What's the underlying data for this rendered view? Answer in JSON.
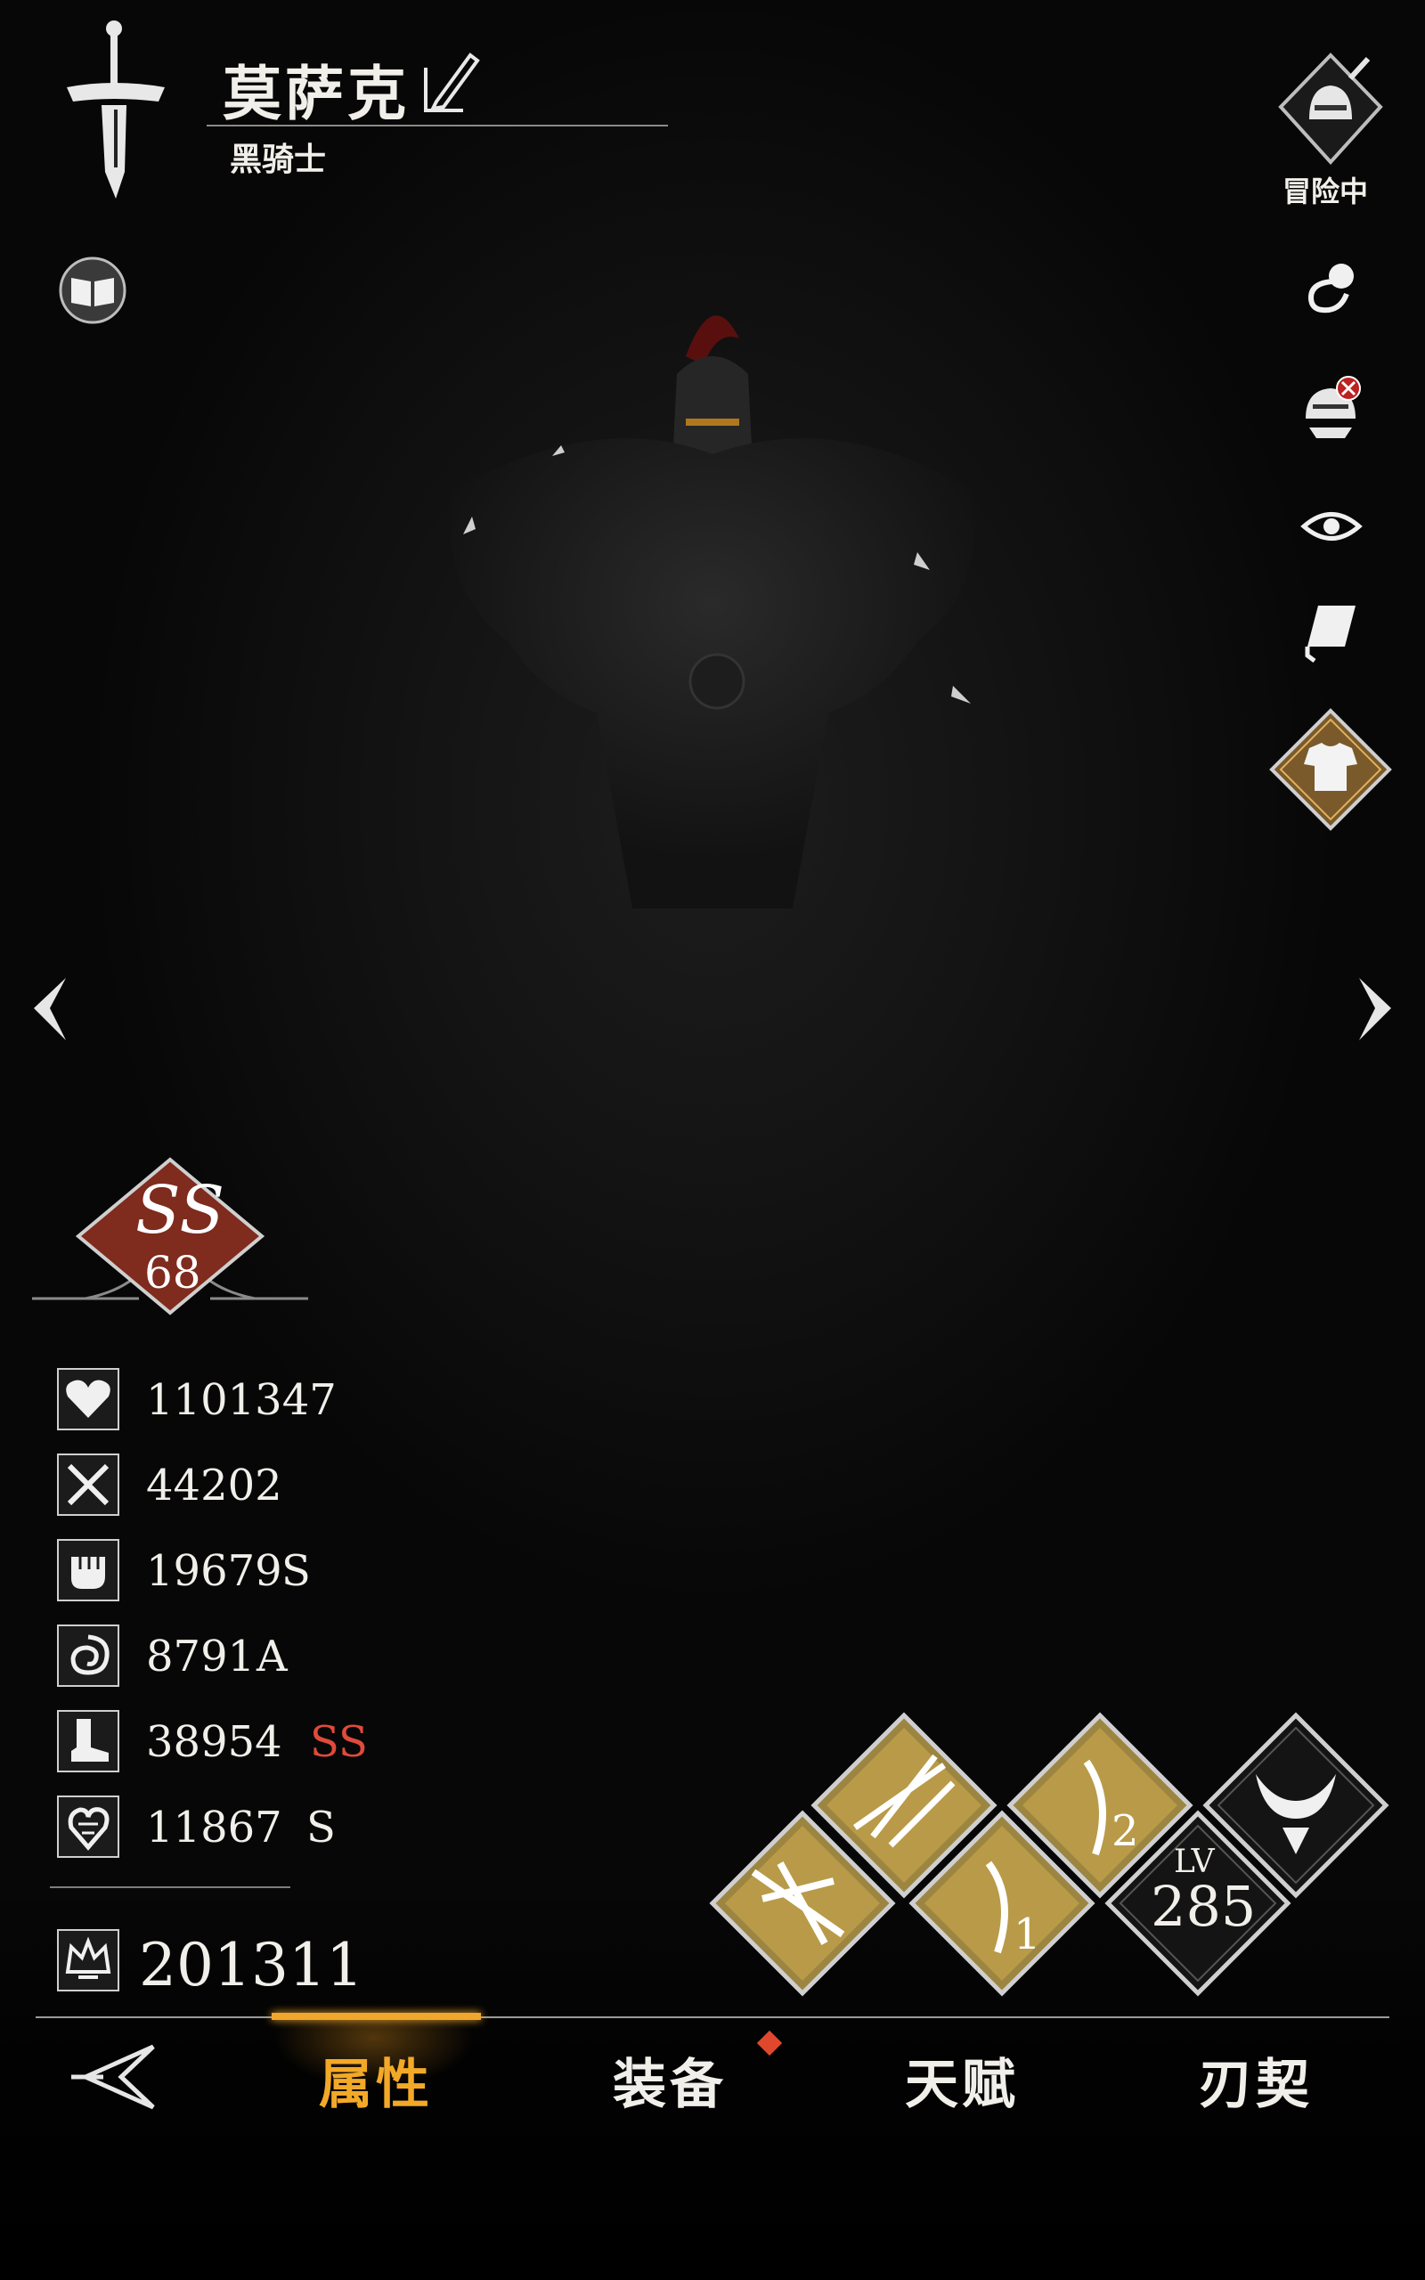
{
  "character": {
    "name": "莫萨克",
    "class": "黑骑士",
    "status": "冒险中",
    "rank": {
      "grade": "SS",
      "level": "68"
    }
  },
  "stats": [
    {
      "icon": "heart-icon",
      "value": "1101347",
      "grade": ""
    },
    {
      "icon": "crossed-swords-icon",
      "value": "44202",
      "grade": ""
    },
    {
      "icon": "fist-icon",
      "value": "19679",
      "grade": "S"
    },
    {
      "icon": "vortex-icon",
      "value": "8791",
      "grade": "A"
    },
    {
      "icon": "boot-icon",
      "value": "38954",
      "grade": "SS"
    },
    {
      "icon": "heart-crystal-icon",
      "value": "11867",
      "grade": "S"
    }
  ],
  "power": {
    "icon": "crown-icon",
    "value": "201311"
  },
  "level": {
    "label": "LV",
    "value": "285"
  },
  "skills": [
    {
      "icon": "slash-skill-icon"
    },
    {
      "icon": "claw-skill-icon"
    },
    {
      "icon": "sword-one-skill-icon",
      "number": "1"
    },
    {
      "icon": "sword-two-skill-icon",
      "number": "2"
    },
    {
      "icon": "horned-skill-icon"
    }
  ],
  "tabs": [
    {
      "label": "属性",
      "active": true
    },
    {
      "label": "装备",
      "active": false,
      "badge": true
    },
    {
      "label": "天赋",
      "active": false
    },
    {
      "label": "刃契",
      "active": false
    }
  ],
  "colors": {
    "accent": "#f0a72c",
    "grade_ss": "#e14a3a",
    "rank_badge": "#8a2e1f",
    "skill_gold": "#c8a84a"
  }
}
